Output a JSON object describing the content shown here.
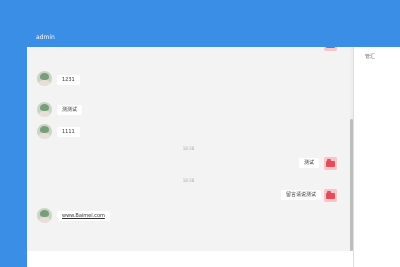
{
  "header": {
    "title": "admin"
  },
  "sidepanel": {
    "label": "管汇"
  },
  "messages": [
    {
      "side": "left",
      "text": "1231"
    },
    {
      "side": "left",
      "text": "测测试"
    },
    {
      "side": "left",
      "text": "1111"
    },
    {
      "side": "time",
      "text": "18:38"
    },
    {
      "side": "right",
      "text": "测试"
    },
    {
      "side": "time",
      "text": "18:38"
    },
    {
      "side": "right",
      "text": "留言请说测试"
    },
    {
      "side": "left",
      "text": "www.Baimei.com"
    }
  ],
  "colors": {
    "header": "#3a8ee6",
    "chat_bg": "#f3f3f3",
    "bubble": "#ffffff"
  }
}
